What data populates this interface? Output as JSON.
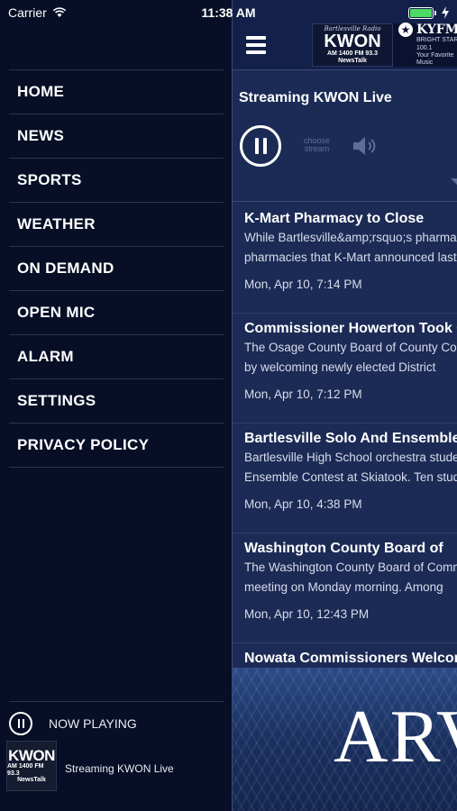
{
  "status_bar": {
    "carrier": "Carrier",
    "time": "11:38 AM"
  },
  "menu": {
    "items": [
      {
        "label": "HOME"
      },
      {
        "label": "NEWS"
      },
      {
        "label": "SPORTS"
      },
      {
        "label": "WEATHER"
      },
      {
        "label": "ON DEMAND"
      },
      {
        "label": "OPEN MIC"
      },
      {
        "label": "ALARM"
      },
      {
        "label": "SETTINGS"
      },
      {
        "label": "PRIVACY POLICY"
      }
    ]
  },
  "now_playing": {
    "label": "NOW PLAYING",
    "stream_name": "Streaming KWON Live",
    "logo": {
      "name": "KWON",
      "line": "AM 1400 FM 93.3",
      "tag": "NewsTalk"
    }
  },
  "header": {
    "kwon_logo": {
      "script": "Bartlesville Radio",
      "name": "KWON",
      "line": "AM 1400 FM 93.3",
      "tag": "NewsTalk"
    },
    "kyfm_logo": {
      "name": "KYFM",
      "sub": "BRIGHT STAR",
      "freq": "100.1",
      "tag": "Your Favorite Music"
    }
  },
  "player": {
    "title": "Streaming KWON Live",
    "choose_stream_line1": "choose",
    "choose_stream_line2": "stream"
  },
  "news": [
    {
      "title": "K-Mart Pharmacy to Close",
      "desc1": "While Bartlesville&amp;rsquo;s pharmacy",
      "desc2": "pharmacies that K-Mart announced last",
      "date": "Mon, Apr 10, 7:14 PM"
    },
    {
      "title": "Commissioner Howerton Took Oath",
      "desc1": "The Osage County Board of County Commissioners",
      "desc2": "by welcoming newly elected District",
      "date": "Mon, Apr 10, 7:12 PM"
    },
    {
      "title": "Bartlesville Solo And Ensemble",
      "desc1": "Bartlesville High School orchestra students",
      "desc2": "Ensemble Contest at Skiatook. Ten students",
      "date": "Mon, Apr 10, 4:38 PM"
    },
    {
      "title": "Washington County Board of",
      "desc1": "The Washington County Board of Commissioners",
      "desc2": "meeting on Monday morning. Among",
      "date": "Mon, Apr 10, 12:43 PM"
    },
    {
      "title": "Nowata Commissioners Welcome"
    }
  ],
  "banner": {
    "text": "ARVEST"
  }
}
